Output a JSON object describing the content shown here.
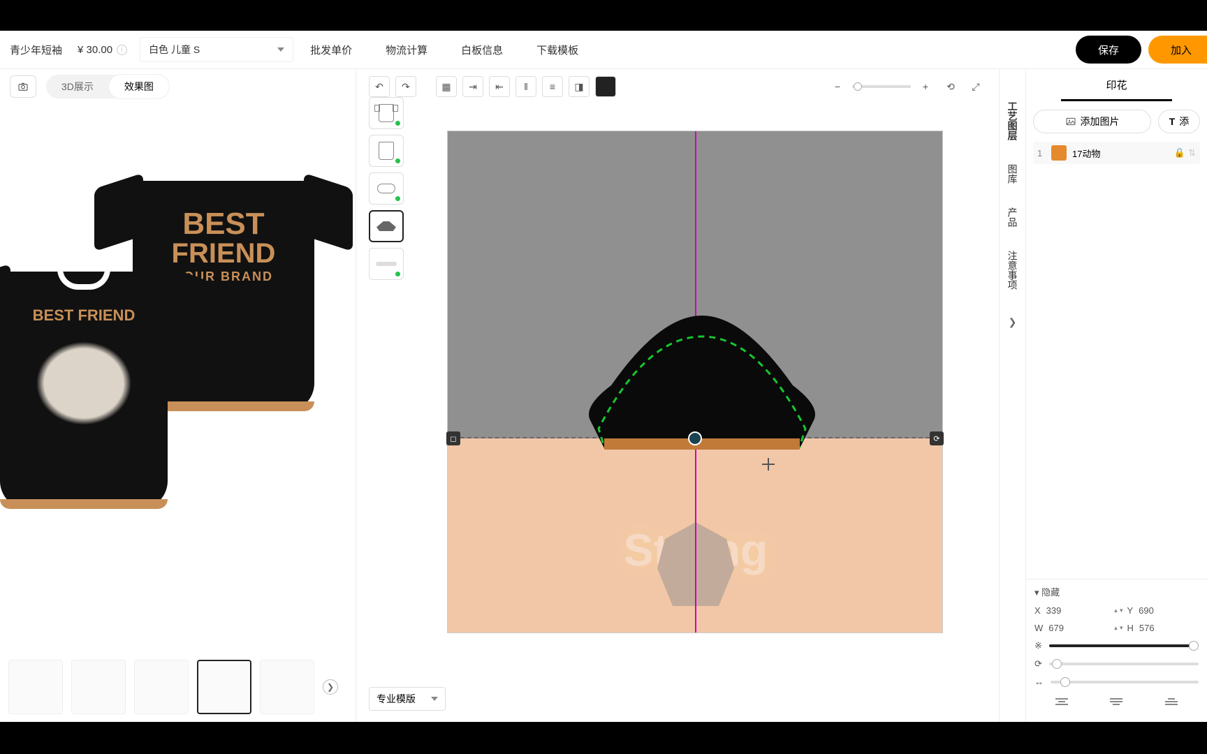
{
  "topbar": {
    "product": "青少年短袖",
    "price": "¥ 30.00",
    "variant": "白色 儿童 S",
    "links": {
      "bulk": "批发单价",
      "shipping": "物流计算",
      "blank": "白板信息",
      "download": "下载模板"
    },
    "save": "保存",
    "add": "加入"
  },
  "left": {
    "tab3d": "3D展示",
    "tabRender": "效果图",
    "back": {
      "l1": "BEST",
      "l2": "FRIEND",
      "l3": "YOUR BRAND"
    },
    "front": {
      "title": "BEST FRIEND"
    }
  },
  "editor": {
    "mode": "专业模版",
    "ghost_text": "Strong"
  },
  "rail": {
    "layers": "工艺图层",
    "gallery": "图库",
    "product": "产品",
    "notes": "注意事项"
  },
  "right": {
    "tab": "印花",
    "addImage": "添加图片",
    "addText": "添",
    "layer": {
      "index": "1",
      "name": "17动物"
    },
    "collapse": "▾ 隐藏",
    "pos": {
      "x_label": "X",
      "x": "339",
      "y_label": "Y",
      "y": "690"
    },
    "size": {
      "w_label": "W",
      "w": "679",
      "h_label": "H",
      "h": "576"
    }
  }
}
